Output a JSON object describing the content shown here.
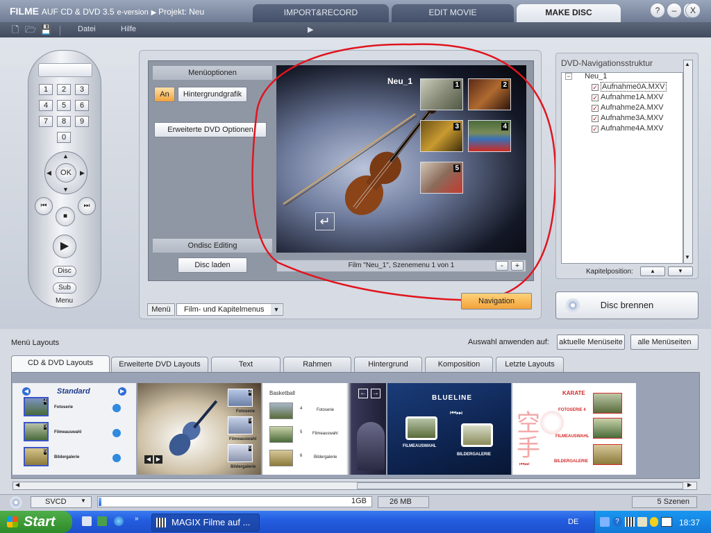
{
  "window": {
    "app_title_bold": "FILME",
    "app_title_rest": "AUF CD & DVD 3.5",
    "edition": "e-version",
    "project": "Projekt: Neu",
    "tabs": [
      {
        "label": "IMPORT&RECORD"
      },
      {
        "label": "EDIT MOVIE"
      },
      {
        "label": "MAKE DISC"
      }
    ],
    "buttons": {
      "help": "?",
      "minimize": "–",
      "maximize": "□",
      "close": "X"
    }
  },
  "menubar": {
    "items": [
      "Datei",
      "Hilfe"
    ],
    "arrow": "▶"
  },
  "remote": {
    "keys": [
      "1",
      "2",
      "3",
      "4",
      "5",
      "6",
      "7",
      "8",
      "9",
      "0"
    ],
    "ok": "OK",
    "disc": "Disc",
    "sub": "Sub",
    "menu": "Menu"
  },
  "editor": {
    "menu_options_title": "Menüoptionen",
    "an_button": "An",
    "background_button": "Hintergrundgrafik",
    "advanced_button": "Erweiterte DVD Optionen",
    "ondisc_title": "Ondisc Editing",
    "load_disc_button": "Disc laden",
    "preview_title": "Neu_1",
    "thumb_numbers": [
      "1",
      "2",
      "3",
      "4",
      "5"
    ],
    "return_glyph": "↵",
    "status": "Film \"Neu_1\", Szenemenu 1 von 1",
    "minus": "-",
    "plus": "+",
    "menu_label": "Menü",
    "menu_select_value": "Film- und Kapitelmenus",
    "navigation_button": "Navigation"
  },
  "dvd_nav": {
    "title": "DVD-Navigationsstruktur",
    "root": "Neu_1",
    "items": [
      "Aufnahme0A.MXV",
      "Aufnahme1A.MXV",
      "Aufnahme2A.MXV",
      "Aufnahme3A.MXV",
      "Aufnahme4A.MXV"
    ],
    "chapter_label": "Kapitelposition:",
    "burn_button": "Disc brennen"
  },
  "layouts": {
    "title": "Menü Layouts",
    "apply_label": "Auswahl anwenden auf:",
    "current_page_button": "aktuelle Menüseite",
    "all_pages_button": "alle Menüseiten",
    "tabs": [
      "CD & DVD Layouts",
      "Erweiterte DVD Layouts",
      "Text",
      "Rahmen",
      "Hintergrund",
      "Komposition",
      "Letzte Layouts"
    ],
    "standard": {
      "title": "Standard",
      "labels": [
        "Fotoserie",
        "Filmeauswahl",
        "Bildergalerie"
      ],
      "nums": [
        "4",
        "5",
        "6"
      ]
    },
    "classic": {
      "labels": [
        "Fotoserie",
        "Filmeauswahl",
        "Bildergalerie"
      ],
      "nums": [
        "4",
        "5",
        "6"
      ]
    },
    "basketball": {
      "title": "Basketball",
      "labels": [
        "Fotoserie",
        "Filmeauswahl",
        "Bildergalerie"
      ],
      "nums": [
        "4",
        "5",
        "6"
      ]
    },
    "blueline": {
      "title": "BLUELINE",
      "labels": [
        "FILMEAUSWAHL",
        "BILDERGALERIE"
      ]
    },
    "karate": {
      "title": "KARATE",
      "labels": [
        "FOTOSERIE 4",
        "FILMEAUSWAHL",
        "BILDERGALERIE"
      ],
      "glyph": "空手"
    }
  },
  "bottom": {
    "format": "SVCD",
    "capacity": "1GB",
    "used": "26 MB",
    "scenes": "5 Szenen"
  },
  "taskbar": {
    "start": "Start",
    "task": "MAGIX Filme auf ...",
    "lang": "DE",
    "time": "18:37"
  },
  "colors": {
    "accent_orange": "#f2a23a",
    "annotation_red": "#e0141e",
    "taskbar_blue": "#245ee0"
  }
}
